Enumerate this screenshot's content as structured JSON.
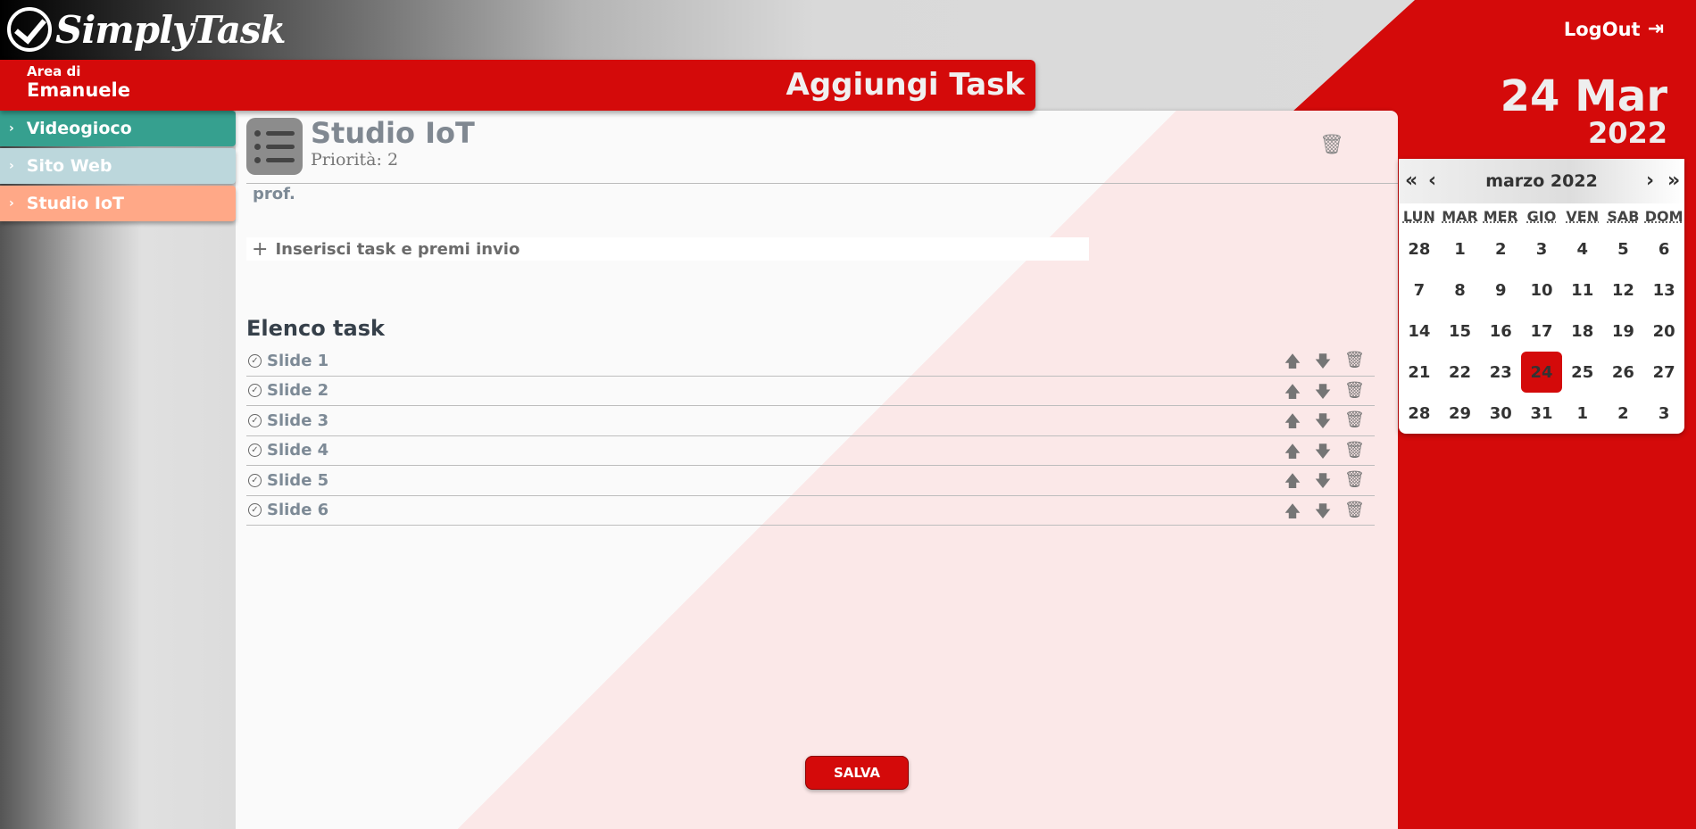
{
  "app": {
    "brand": "SimplyTask",
    "logout_label": "LogOut"
  },
  "user": {
    "area_label": "Area di",
    "name": "Emanuele"
  },
  "page_title": "Aggiungi Task",
  "date": {
    "day_month": "24 Mar",
    "year": "2022"
  },
  "sidebar": {
    "items": [
      {
        "label": "Videogioco",
        "color": "#36a08f"
      },
      {
        "label": "Sito Web",
        "color": "#bcd7dc"
      },
      {
        "label": "Studio IoT",
        "color": "#ffa887"
      }
    ]
  },
  "project": {
    "title": "Studio IoT",
    "priority": "Priorità: 2",
    "description": "prof.",
    "new_task_placeholder": "Inserisci task e premi invio",
    "list_header": "Elenco task",
    "tasks": [
      "Slide 1",
      "Slide 2",
      "Slide 3",
      "Slide 4",
      "Slide 5",
      "Slide 6"
    ],
    "save_label": "SALVA"
  },
  "calendar": {
    "nav": {
      "prev_year": "«",
      "prev_month": "‹",
      "next_month": "›",
      "next_year": "»"
    },
    "month_label": "marzo 2022",
    "weekdays": [
      "LUN",
      "MAR",
      "MER",
      "GIO",
      "VEN",
      "SAB",
      "DOM"
    ],
    "days": [
      "28",
      "1",
      "2",
      "3",
      "4",
      "5",
      "6",
      "7",
      "8",
      "9",
      "10",
      "11",
      "12",
      "13",
      "14",
      "15",
      "16",
      "17",
      "18",
      "19",
      "20",
      "21",
      "22",
      "23",
      "24",
      "25",
      "26",
      "27",
      "28",
      "29",
      "30",
      "31",
      "1",
      "2",
      "3"
    ],
    "selected": "24"
  },
  "colors": {
    "accent": "#d40a0a"
  }
}
